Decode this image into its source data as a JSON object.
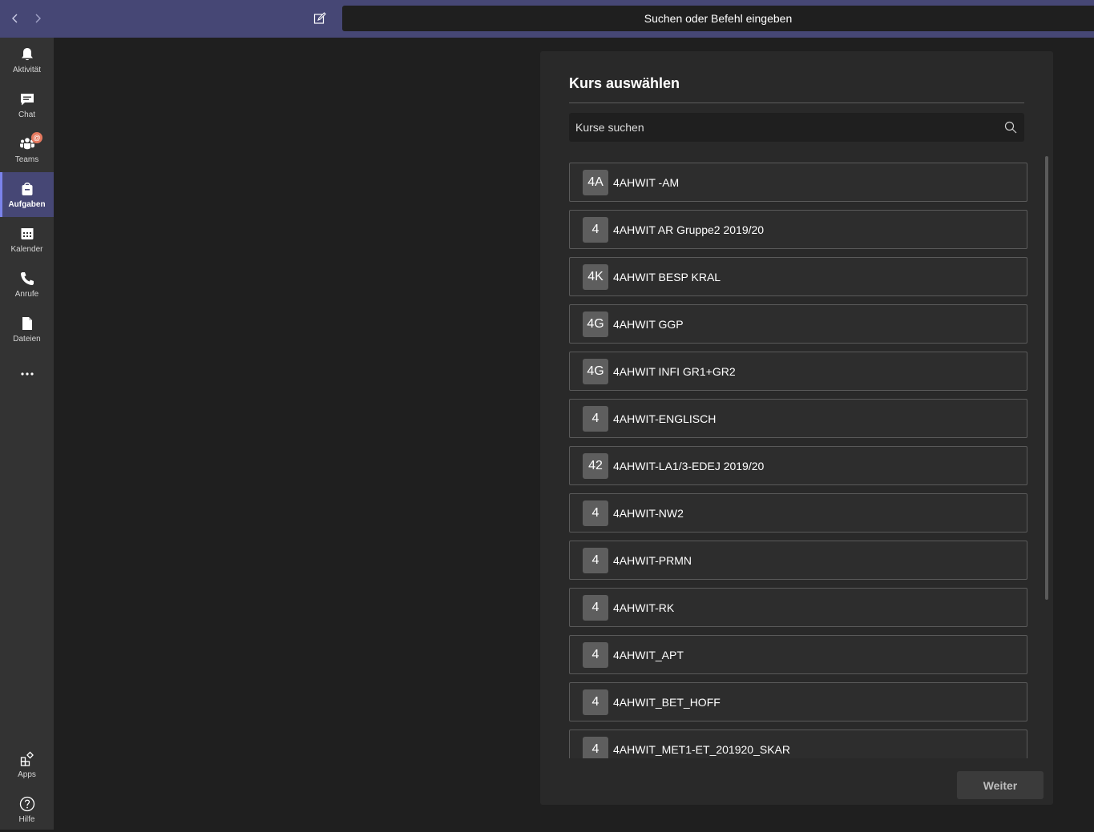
{
  "header": {
    "search_placeholder": "Suchen oder Befehl eingeben"
  },
  "rail": {
    "items": [
      {
        "label": "Aktivität",
        "icon": "bell-icon"
      },
      {
        "label": "Chat",
        "icon": "chat-icon"
      },
      {
        "label": "Teams",
        "icon": "teams-icon",
        "badge": "@"
      },
      {
        "label": "Aufgaben",
        "icon": "assignments-icon",
        "active": true
      },
      {
        "label": "Kalender",
        "icon": "calendar-icon"
      },
      {
        "label": "Anrufe",
        "icon": "phone-icon"
      },
      {
        "label": "Dateien",
        "icon": "file-icon"
      },
      {
        "label": "",
        "icon": "more-icon"
      }
    ],
    "bottom": [
      {
        "label": "Apps",
        "icon": "apps-icon"
      },
      {
        "label": "Hilfe",
        "icon": "help-icon"
      }
    ]
  },
  "dialog": {
    "title": "Kurs auswählen",
    "search_placeholder": "Kurse suchen",
    "courses": [
      {
        "initials": "4A",
        "name": "4AHWIT -AM"
      },
      {
        "initials": "4",
        "name": "4AHWIT AR Gruppe2 2019/20"
      },
      {
        "initials": "4K",
        "name": "4AHWIT BESP KRAL"
      },
      {
        "initials": "4G",
        "name": "4AHWIT GGP"
      },
      {
        "initials": "4G",
        "name": "4AHWIT INFI GR1+GR2"
      },
      {
        "initials": "4",
        "name": "4AHWIT-ENGLISCH"
      },
      {
        "initials": "42",
        "name": "4AHWIT-LA1/3-EDEJ 2019/20"
      },
      {
        "initials": "4",
        "name": "4AHWIT-NW2"
      },
      {
        "initials": "4",
        "name": "4AHWIT-PRMN"
      },
      {
        "initials": "4",
        "name": "4AHWIT-RK"
      },
      {
        "initials": "4",
        "name": "4AHWIT_APT"
      },
      {
        "initials": "4",
        "name": "4AHWIT_BET_HOFF"
      },
      {
        "initials": "4",
        "name": "4AHWIT_MET1-ET_201920_SKAR"
      }
    ],
    "next_label": "Weiter"
  },
  "colors": {
    "header": "#464775",
    "rail": "#333333",
    "active_accent": "#7b83eb",
    "badge": "#e5795f"
  }
}
